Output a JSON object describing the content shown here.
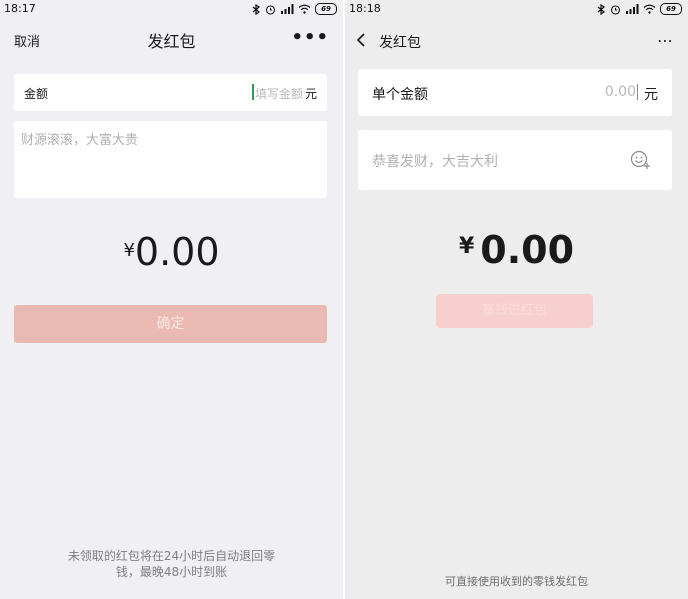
{
  "left": {
    "status": {
      "time": "18:17",
      "battery": "69"
    },
    "nav": {
      "cancel": "取消",
      "title": "发红包",
      "more": "•••"
    },
    "amount": {
      "label": "金额",
      "placeholder": "填写金额",
      "unit": "元"
    },
    "message": {
      "placeholder": "财源滚滚，大富大贵"
    },
    "money": {
      "currency": "¥",
      "value": "0.00"
    },
    "confirm": {
      "label": "确定"
    },
    "footer": {
      "line1": "未领取的红包将在24小时后自动退回零",
      "line2": "钱，最晚48小时到账"
    },
    "colors": {
      "confirm_bg": "#eab9b1",
      "cursor": "#2a9a58"
    }
  },
  "right": {
    "status": {
      "time": "18:18",
      "battery": "69"
    },
    "nav": {
      "back_icon": "chevron-left-icon",
      "title": "发红包",
      "more": "⋯"
    },
    "amount": {
      "label": "单个金额",
      "placeholder": "0.00",
      "unit": "元"
    },
    "message": {
      "placeholder": "恭喜发财，大吉大利",
      "emoji_icon": "emoji-add-icon"
    },
    "money": {
      "currency": "¥",
      "value": "0.00"
    },
    "confirm": {
      "label": "塞钱进红包"
    },
    "footer": {
      "text": "可直接使用收到的零钱发红包"
    },
    "colors": {
      "confirm_bg": "#f8cfcf"
    }
  }
}
